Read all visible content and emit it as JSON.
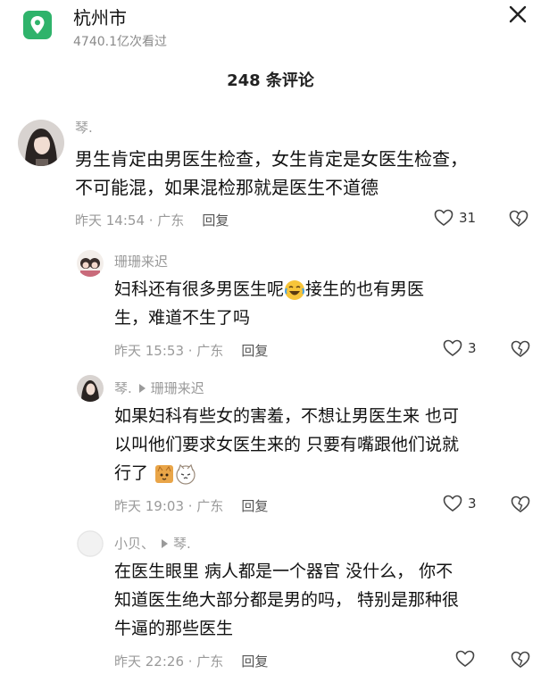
{
  "header": {
    "location": "杭州市",
    "views": "4740.1亿次看过",
    "location_icon": "map-pin-icon",
    "close_icon": "close-icon"
  },
  "comment_count": "248 条评论",
  "comments": [
    {
      "user": "琴.",
      "text_line1": "男生肯定由男医生检查，女生肯定是女医生检查，",
      "text_line2": "不可能混，如果混检那就是医生不道德",
      "time": "昨天 14:54 · 广东",
      "reply": "回复",
      "likes": "31"
    },
    {
      "user": "珊珊来迟",
      "text_line1a": "妇科还有很多男医生呢",
      "text_line1b": "接生的也有男医",
      "text_line2": "生，难道不生了吗",
      "time": "昨天 15:53 · 广东",
      "reply": "回复",
      "likes": "3"
    },
    {
      "user": "琴.",
      "reply_to": "珊珊来迟",
      "text_line1": "如果妇科有些女的害羞，不想让男医生来 也可",
      "text_line2": "以叫他们要求女医生来的 只要有嘴跟他们说就",
      "text_line3": "行了",
      "time": "昨天 19:03 · 广东",
      "reply": "回复",
      "likes": "3"
    },
    {
      "user": "小贝、",
      "reply_to": "琴.",
      "text_line1": "在医生眼里 病人都是一个器官 没什么， 你不",
      "text_line2": "知道医生绝大部分都是男的吗， 特别是那种很",
      "text_line3": "牛逼的那些医生",
      "time": "昨天 22:26 · 广东",
      "reply": "回复",
      "likes": ""
    }
  ],
  "colors": {
    "accent_green": "#2fb36b",
    "meta_gray": "#9a9a9a"
  }
}
